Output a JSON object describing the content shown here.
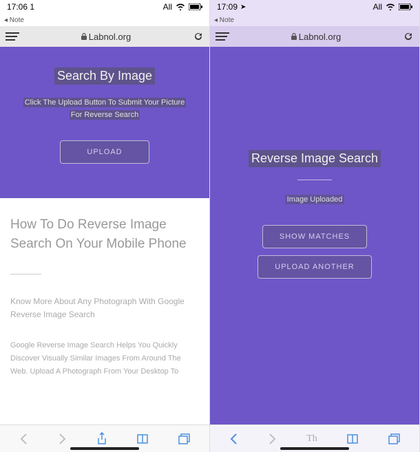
{
  "left": {
    "status": {
      "time": "17:06 1",
      "right_label": "All"
    },
    "back_note": "◂ Note",
    "browser": {
      "url": "Labnol.org"
    },
    "hero": {
      "title": "Search By Image",
      "subtitle_line1": "Click The Upload Button To Submit Your Picture",
      "subtitle_line2": "For Reverse Search",
      "upload_label": "UPLOAD"
    },
    "article": {
      "title": "How To Do Reverse Image Search On Your Mobile Phone",
      "lead": "Know More About Any Photograph With Google Reverse Image Search",
      "body": "Google Reverse Image Search Helps You Quickly Discover Visually Similar Images From Around The Web. Upload A Photograph From Your Desktop To"
    }
  },
  "right": {
    "status": {
      "time": "17:09",
      "right_label": "All"
    },
    "back_note": "◂ Note",
    "browser": {
      "url": "Labnol.org"
    },
    "hero": {
      "title": "Reverse Image Search",
      "status": "Image Uploaded",
      "show_label": "SHOW MATCHES",
      "another_label": "UPLOAD ANOTHER"
    },
    "reader": "Th"
  }
}
